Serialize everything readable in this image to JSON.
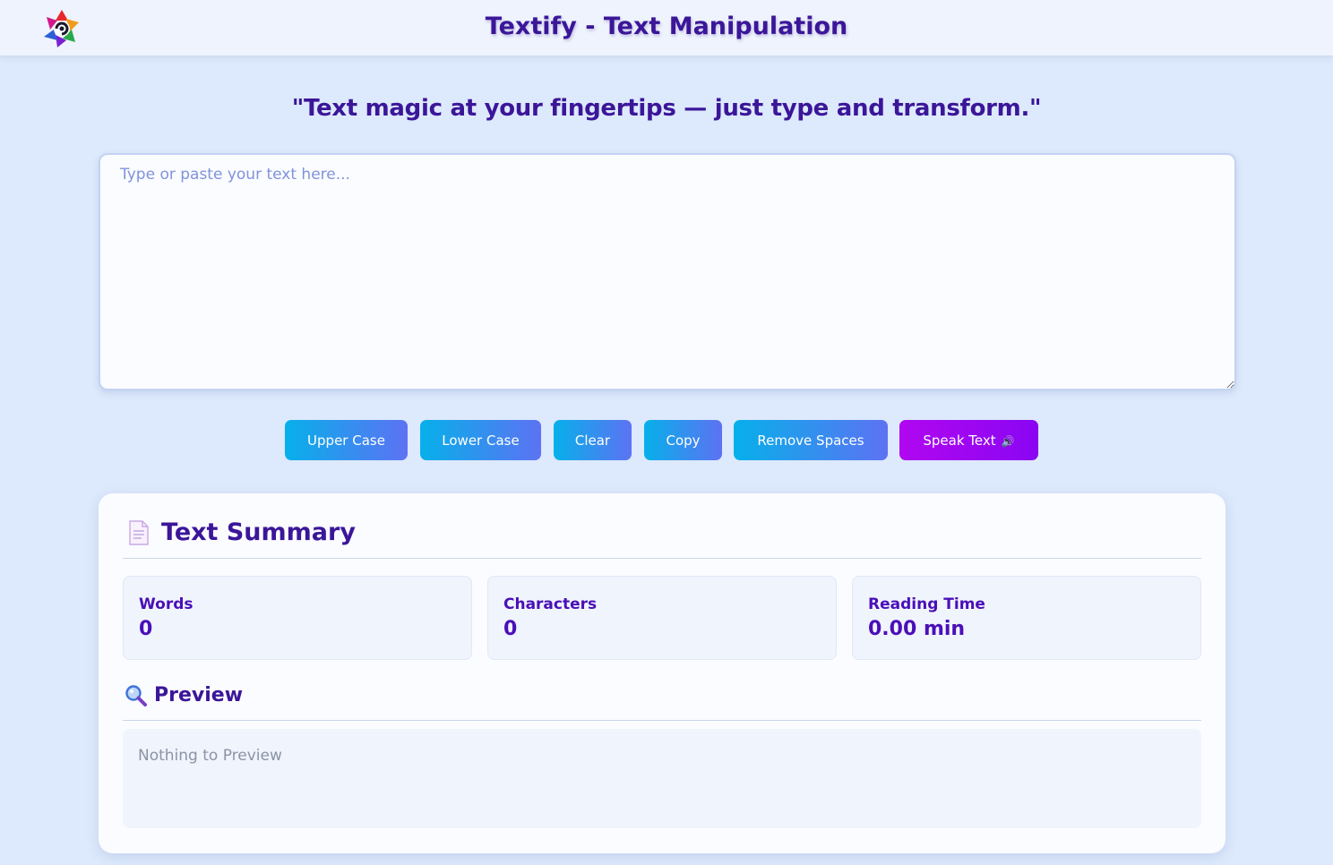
{
  "header": {
    "title": "Textify - Text Manipulation",
    "logo_icon": "swirl-logo-icon"
  },
  "tagline": "\"Text magic at your fingertips — just type and transform.\"",
  "editor": {
    "placeholder": "Type or paste your text here...",
    "value": ""
  },
  "buttons": {
    "upper_case": "Upper Case",
    "lower_case": "Lower Case",
    "clear": "Clear",
    "copy": "Copy",
    "remove_spaces": "Remove Spaces",
    "speak_text": "Speak Text",
    "speak_icon": "speaker-icon"
  },
  "summary": {
    "title": "Text Summary",
    "icon": "document-icon",
    "stats": [
      {
        "label": "Words",
        "value": "0"
      },
      {
        "label": "Characters",
        "value": "0"
      },
      {
        "label": "Reading Time",
        "value": "0.00 min"
      }
    ]
  },
  "preview": {
    "title": "Preview",
    "icon": "magnifier-icon",
    "text": "Nothing to Preview"
  },
  "colors": {
    "accent": "#3b1699",
    "stat_text": "#4a0fb8",
    "button_gradient_start": "#06b0ea",
    "button_gradient_end": "#5d72f3",
    "speak_gradient_start": "#b007f0",
    "speak_gradient_end": "#8a05f2",
    "background": "#dde9fc"
  }
}
